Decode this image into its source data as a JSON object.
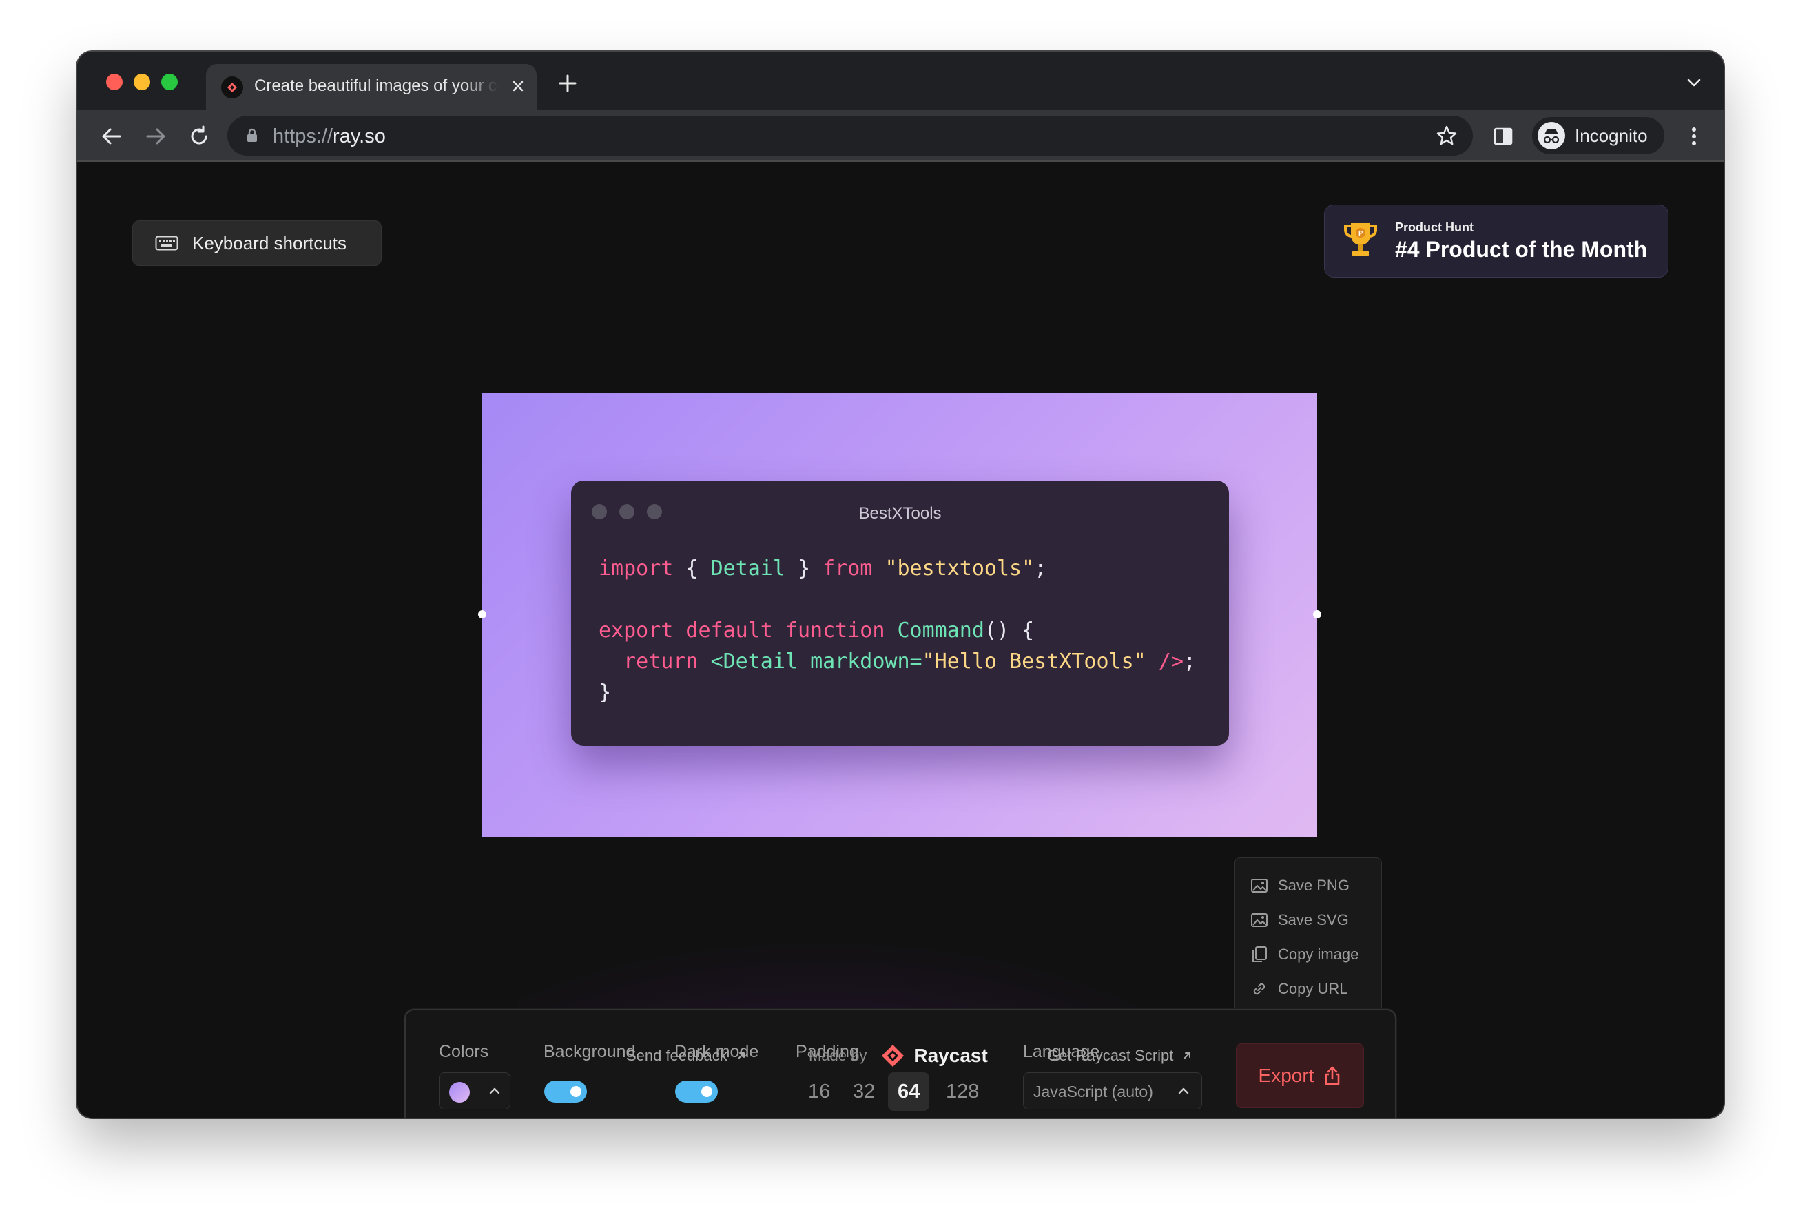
{
  "browser": {
    "tab_title": "Create beautiful images of your code",
    "url_scheme": "https://",
    "url_host": "ray.so",
    "profile_label": "Incognito"
  },
  "page": {
    "keyboard_shortcuts_label": "Keyboard shortcuts",
    "product_hunt": {
      "small": "Product Hunt",
      "big": "#4 Product of the Month"
    },
    "code_window": {
      "title": "BestXTools",
      "lines": [
        [
          "import",
          " { ",
          "Detail",
          " } ",
          "from",
          " ",
          "\"bestxtools\"",
          ";"
        ],
        [
          "export default function",
          " ",
          "Command",
          "() {"
        ],
        [
          "  return",
          " ",
          "<Detail",
          " ",
          "markdown=",
          "\"Hello BestXTools\"",
          " ",
          "/>",
          ";"
        ],
        [
          "}"
        ]
      ]
    },
    "export_menu": {
      "items": [
        "Save PNG",
        "Save SVG",
        "Copy image",
        "Copy URL"
      ]
    },
    "controls": {
      "colors_label": "Colors",
      "background_label": "Background",
      "dark_mode_label": "Dark mode",
      "padding_label": "Padding",
      "padding_options": [
        "16",
        "32",
        "64",
        "128"
      ],
      "padding_selected": "64",
      "language_label": "Language",
      "language_value": "JavaScript (auto)",
      "export_label": "Export"
    },
    "footer": {
      "send_feedback": "Send feedback",
      "made_by": "Made by",
      "brand": "Raycast",
      "get_script": "Get Raycast Script"
    }
  },
  "colors": {
    "accent_toggle": "#4fb8f0",
    "export_red": "#ff6363",
    "keyword": "#ff5d8f",
    "function": "#6ee3b4",
    "string": "#fcd786"
  }
}
